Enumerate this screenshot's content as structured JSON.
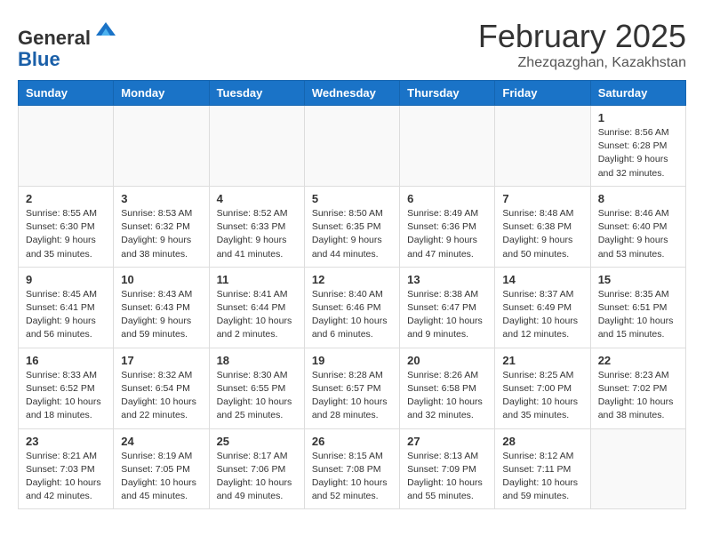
{
  "header": {
    "logo_line1": "General",
    "logo_line2": "Blue",
    "month_title": "February 2025",
    "location": "Zhezqazghan, Kazakhstan"
  },
  "weekdays": [
    "Sunday",
    "Monday",
    "Tuesday",
    "Wednesday",
    "Thursday",
    "Friday",
    "Saturday"
  ],
  "weeks": [
    [
      {
        "day": "",
        "info": ""
      },
      {
        "day": "",
        "info": ""
      },
      {
        "day": "",
        "info": ""
      },
      {
        "day": "",
        "info": ""
      },
      {
        "day": "",
        "info": ""
      },
      {
        "day": "",
        "info": ""
      },
      {
        "day": "1",
        "info": "Sunrise: 8:56 AM\nSunset: 6:28 PM\nDaylight: 9 hours and 32 minutes."
      }
    ],
    [
      {
        "day": "2",
        "info": "Sunrise: 8:55 AM\nSunset: 6:30 PM\nDaylight: 9 hours and 35 minutes."
      },
      {
        "day": "3",
        "info": "Sunrise: 8:53 AM\nSunset: 6:32 PM\nDaylight: 9 hours and 38 minutes."
      },
      {
        "day": "4",
        "info": "Sunrise: 8:52 AM\nSunset: 6:33 PM\nDaylight: 9 hours and 41 minutes."
      },
      {
        "day": "5",
        "info": "Sunrise: 8:50 AM\nSunset: 6:35 PM\nDaylight: 9 hours and 44 minutes."
      },
      {
        "day": "6",
        "info": "Sunrise: 8:49 AM\nSunset: 6:36 PM\nDaylight: 9 hours and 47 minutes."
      },
      {
        "day": "7",
        "info": "Sunrise: 8:48 AM\nSunset: 6:38 PM\nDaylight: 9 hours and 50 minutes."
      },
      {
        "day": "8",
        "info": "Sunrise: 8:46 AM\nSunset: 6:40 PM\nDaylight: 9 hours and 53 minutes."
      }
    ],
    [
      {
        "day": "9",
        "info": "Sunrise: 8:45 AM\nSunset: 6:41 PM\nDaylight: 9 hours and 56 minutes."
      },
      {
        "day": "10",
        "info": "Sunrise: 8:43 AM\nSunset: 6:43 PM\nDaylight: 9 hours and 59 minutes."
      },
      {
        "day": "11",
        "info": "Sunrise: 8:41 AM\nSunset: 6:44 PM\nDaylight: 10 hours and 2 minutes."
      },
      {
        "day": "12",
        "info": "Sunrise: 8:40 AM\nSunset: 6:46 PM\nDaylight: 10 hours and 6 minutes."
      },
      {
        "day": "13",
        "info": "Sunrise: 8:38 AM\nSunset: 6:47 PM\nDaylight: 10 hours and 9 minutes."
      },
      {
        "day": "14",
        "info": "Sunrise: 8:37 AM\nSunset: 6:49 PM\nDaylight: 10 hours and 12 minutes."
      },
      {
        "day": "15",
        "info": "Sunrise: 8:35 AM\nSunset: 6:51 PM\nDaylight: 10 hours and 15 minutes."
      }
    ],
    [
      {
        "day": "16",
        "info": "Sunrise: 8:33 AM\nSunset: 6:52 PM\nDaylight: 10 hours and 18 minutes."
      },
      {
        "day": "17",
        "info": "Sunrise: 8:32 AM\nSunset: 6:54 PM\nDaylight: 10 hours and 22 minutes."
      },
      {
        "day": "18",
        "info": "Sunrise: 8:30 AM\nSunset: 6:55 PM\nDaylight: 10 hours and 25 minutes."
      },
      {
        "day": "19",
        "info": "Sunrise: 8:28 AM\nSunset: 6:57 PM\nDaylight: 10 hours and 28 minutes."
      },
      {
        "day": "20",
        "info": "Sunrise: 8:26 AM\nSunset: 6:58 PM\nDaylight: 10 hours and 32 minutes."
      },
      {
        "day": "21",
        "info": "Sunrise: 8:25 AM\nSunset: 7:00 PM\nDaylight: 10 hours and 35 minutes."
      },
      {
        "day": "22",
        "info": "Sunrise: 8:23 AM\nSunset: 7:02 PM\nDaylight: 10 hours and 38 minutes."
      }
    ],
    [
      {
        "day": "23",
        "info": "Sunrise: 8:21 AM\nSunset: 7:03 PM\nDaylight: 10 hours and 42 minutes."
      },
      {
        "day": "24",
        "info": "Sunrise: 8:19 AM\nSunset: 7:05 PM\nDaylight: 10 hours and 45 minutes."
      },
      {
        "day": "25",
        "info": "Sunrise: 8:17 AM\nSunset: 7:06 PM\nDaylight: 10 hours and 49 minutes."
      },
      {
        "day": "26",
        "info": "Sunrise: 8:15 AM\nSunset: 7:08 PM\nDaylight: 10 hours and 52 minutes."
      },
      {
        "day": "27",
        "info": "Sunrise: 8:13 AM\nSunset: 7:09 PM\nDaylight: 10 hours and 55 minutes."
      },
      {
        "day": "28",
        "info": "Sunrise: 8:12 AM\nSunset: 7:11 PM\nDaylight: 10 hours and 59 minutes."
      },
      {
        "day": "",
        "info": ""
      }
    ]
  ]
}
